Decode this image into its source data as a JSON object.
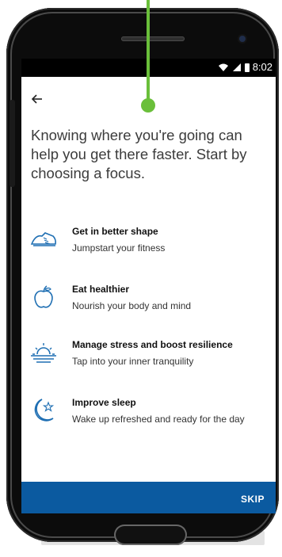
{
  "status": {
    "time": "8:02"
  },
  "header": {
    "back_icon": "arrow-left-icon"
  },
  "headline": "Knowing where you're going can help you get there faster. Start by choosing a focus.",
  "focus_items": [
    {
      "icon": "sneaker-icon",
      "title": "Get in better shape",
      "subtitle": "Jumpstart your fitness"
    },
    {
      "icon": "apple-icon",
      "title": "Eat healthier",
      "subtitle": "Nourish your body and mind"
    },
    {
      "icon": "sunrise-icon",
      "title": "Manage stress and boost resilience",
      "subtitle": "Tap into your inner tranquility"
    },
    {
      "icon": "moon-star-icon",
      "title": "Improve sleep",
      "subtitle": "Wake up refreshed and ready for the day"
    }
  ],
  "footer": {
    "skip_label": "SKIP",
    "bar_color": "#0b5aa0"
  },
  "accent": {
    "pointer_color": "#6abf3a",
    "icon_color": "#1f6fb3"
  }
}
